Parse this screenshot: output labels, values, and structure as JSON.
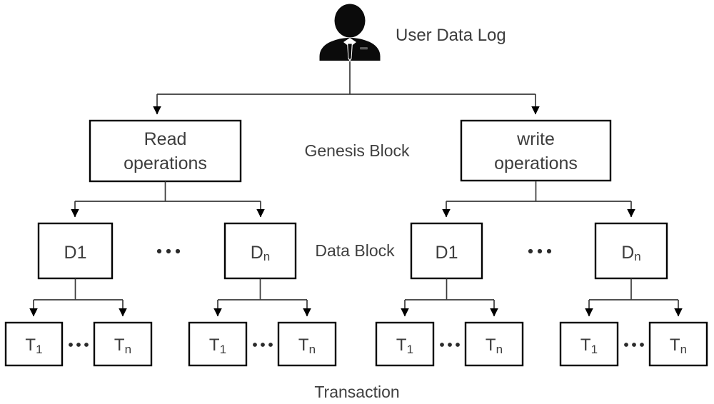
{
  "diagram": {
    "title_label": "User Data Log",
    "tier_labels": {
      "genesis": "Genesis Block",
      "data": "Data Block",
      "transaction": "Transaction"
    },
    "icons": {
      "user": "user-person-icon"
    },
    "colors": {
      "box_stroke": "#000000",
      "connector": "#3a3a3a",
      "text": "#3d3d3d",
      "background": "#ffffff",
      "icon": "#0b0b0b"
    },
    "genesis_blocks": [
      {
        "id": "read",
        "line1": "Read",
        "line2": "operations"
      },
      {
        "id": "write",
        "line1": "write",
        "line2": "operations"
      }
    ],
    "data_blocks": [
      {
        "id": "read-d1",
        "label": "D1",
        "sub": ""
      },
      {
        "id": "read-dn",
        "label": "D",
        "sub": "n"
      },
      {
        "id": "write-d1",
        "label": "D1",
        "sub": ""
      },
      {
        "id": "write-dn",
        "label": "D",
        "sub": "n"
      }
    ],
    "ellipsis": "• • •",
    "transactions": [
      {
        "group": "read-d1",
        "first": {
          "label": "T",
          "sub": "1"
        },
        "last": {
          "label": "T",
          "sub": "n"
        }
      },
      {
        "group": "read-dn",
        "first": {
          "label": "T",
          "sub": "1"
        },
        "last": {
          "label": "T",
          "sub": "n"
        }
      },
      {
        "group": "write-d1",
        "first": {
          "label": "T",
          "sub": "1"
        },
        "last": {
          "label": "T",
          "sub": "n"
        }
      },
      {
        "group": "write-dn",
        "first": {
          "label": "T",
          "sub": "1"
        },
        "last": {
          "label": "T",
          "sub": "n"
        }
      }
    ]
  }
}
